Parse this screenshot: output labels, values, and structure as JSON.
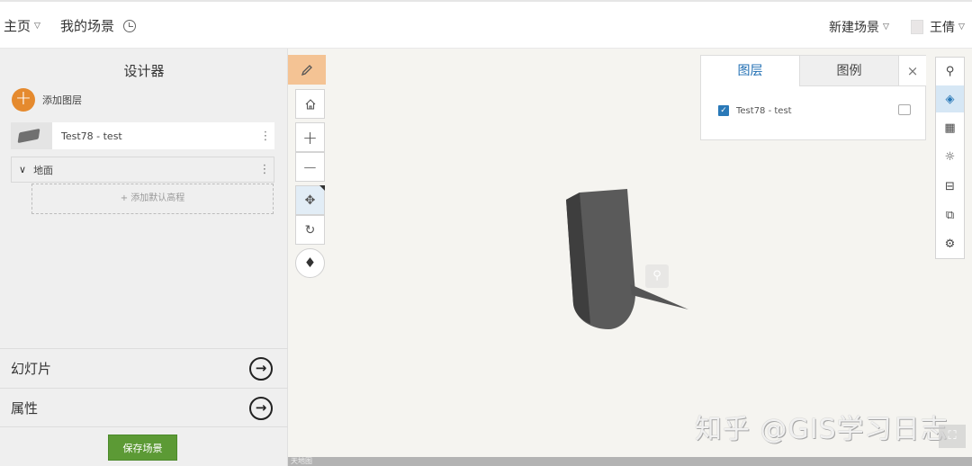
{
  "topbar": {
    "home": "主页",
    "my_scenes": "我的场景",
    "new_scene": "新建场景",
    "user": "王倩"
  },
  "designer": {
    "title": "设计器",
    "add_layer": "添加图层",
    "layer_name": "Test78 - test",
    "ground": "地面",
    "add_elevation": "+ 添加默认高程",
    "slides": "幻灯片",
    "properties": "属性",
    "save": "保存场景"
  },
  "view_tools": [
    "pencil-icon",
    "home-icon",
    "zoom-in-icon",
    "zoom-out-icon",
    "pan-icon",
    "rotate-icon",
    "compass-icon"
  ],
  "right_tools": [
    "search-icon",
    "layers-icon",
    "basemap-icon",
    "daylight-icon",
    "measure-icon",
    "share-icon",
    "settings-icon"
  ],
  "layers_panel": {
    "tab_layers": "图层",
    "tab_legend": "图例",
    "close": "×",
    "layer_name": "Test78 - test",
    "checked": true
  },
  "watermark": "知乎 @GIS学习日志",
  "attribution": "天地图",
  "colors": {
    "accent_orange": "#e58a2e",
    "save_green": "#5c9a35",
    "link_blue": "#1f6eb3",
    "selected_tool_bg": "#d6e7f5"
  }
}
